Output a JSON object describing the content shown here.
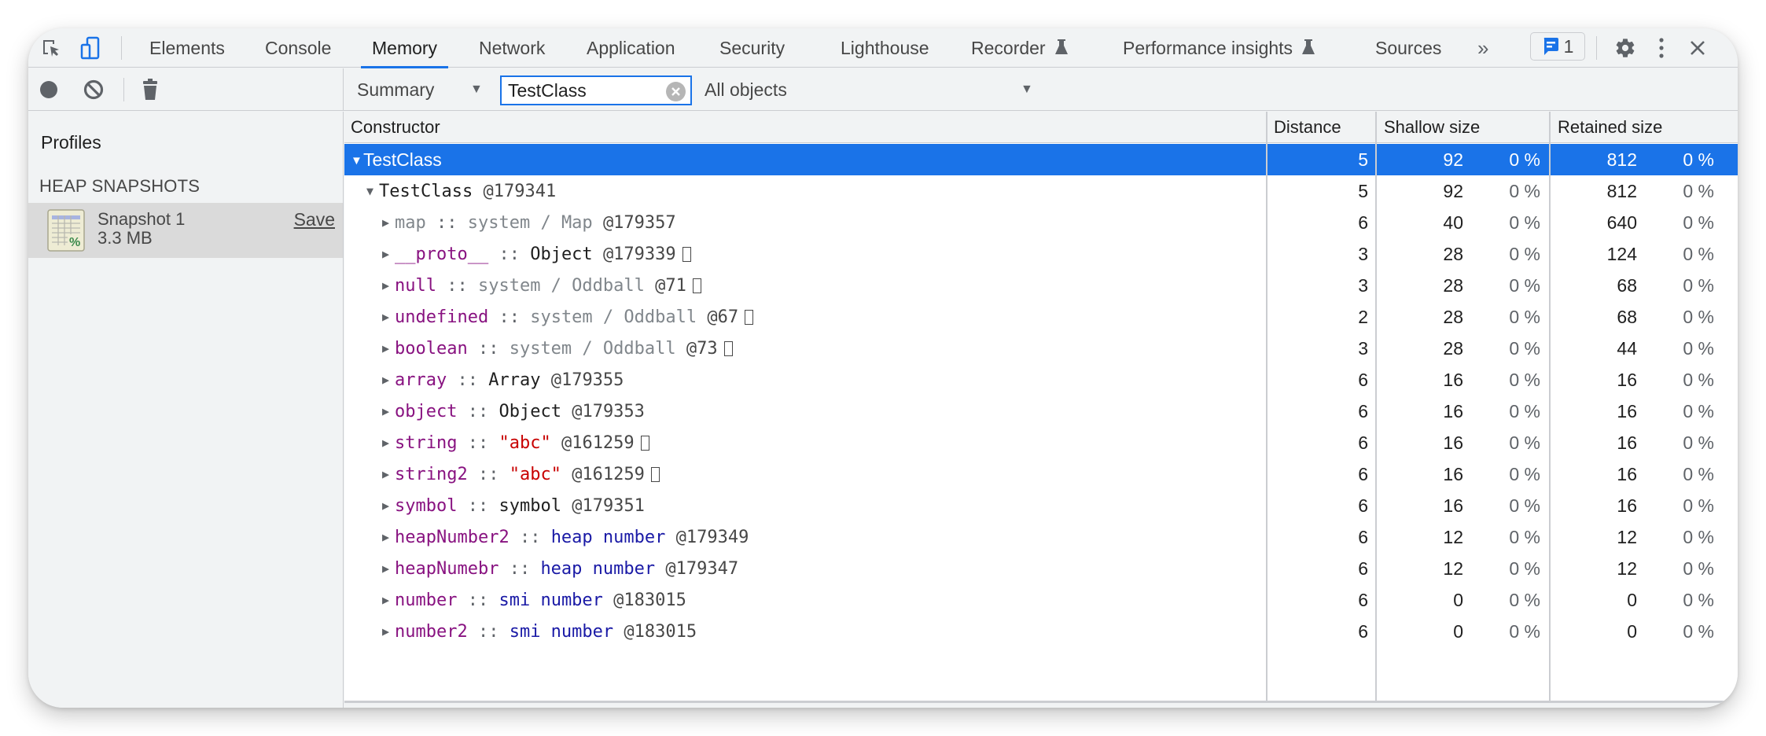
{
  "tabbar": {
    "tabs": [
      {
        "label": "Elements",
        "active": false
      },
      {
        "label": "Console",
        "active": false
      },
      {
        "label": "Memory",
        "active": true
      },
      {
        "label": "Network",
        "active": false
      },
      {
        "label": "Application",
        "active": false
      },
      {
        "label": "Security",
        "active": false
      },
      {
        "label": "Lighthouse",
        "active": false
      },
      {
        "label": "Recorder",
        "active": false,
        "experimental": true
      },
      {
        "label": "Performance insights",
        "active": false,
        "experimental": true
      },
      {
        "label": "Sources",
        "active": false
      }
    ],
    "more_tabs_label": "»",
    "issues_count": "1",
    "accent_color": "#1a73e8"
  },
  "toolbar": {
    "view_select": "Summary",
    "filter_value": "TestClass",
    "objects_select": "All objects"
  },
  "sidebar": {
    "title": "Profiles",
    "section": "HEAP SNAPSHOTS",
    "snapshots": [
      {
        "name": "Snapshot 1",
        "size": "3.3 MB",
        "save_label": "Save"
      }
    ]
  },
  "grid": {
    "columns": {
      "constructor": "Constructor",
      "distance": "Distance",
      "shallow": "Shallow size",
      "retained": "Retained size"
    },
    "rows": [
      {
        "level": 0,
        "expanded": true,
        "selected": true,
        "name": "TestClass",
        "distance": "5",
        "shallow": "92",
        "shallow_pct": "0 %",
        "retained": "812",
        "retained_pct": "0 %"
      },
      {
        "level": 1,
        "expanded": true,
        "prop": "",
        "type": "TestClass",
        "type_kind": "obj",
        "addr": "@179341",
        "box": false,
        "distance": "5",
        "shallow": "92",
        "shallow_pct": "0 %",
        "retained": "812",
        "retained_pct": "0 %"
      },
      {
        "level": 2,
        "prop": "map",
        "prop_kind": "sys",
        "type": "system / Map",
        "type_kind": "sys",
        "addr": "@179357",
        "box": false,
        "distance": "6",
        "shallow": "40",
        "shallow_pct": "0 %",
        "retained": "640",
        "retained_pct": "0 %"
      },
      {
        "level": 2,
        "prop": "__proto__",
        "prop_kind": "prop",
        "type": "Object",
        "type_kind": "obj",
        "addr": "@179339",
        "box": true,
        "distance": "3",
        "shallow": "28",
        "shallow_pct": "0 %",
        "retained": "124",
        "retained_pct": "0 %"
      },
      {
        "level": 2,
        "prop": "null",
        "prop_kind": "prop",
        "type": "system / Oddball",
        "type_kind": "sys",
        "addr": "@71",
        "box": true,
        "distance": "3",
        "shallow": "28",
        "shallow_pct": "0 %",
        "retained": "68",
        "retained_pct": "0 %"
      },
      {
        "level": 2,
        "prop": "undefined",
        "prop_kind": "prop",
        "type": "system / Oddball",
        "type_kind": "sys",
        "addr": "@67",
        "box": true,
        "distance": "2",
        "shallow": "28",
        "shallow_pct": "0 %",
        "retained": "68",
        "retained_pct": "0 %"
      },
      {
        "level": 2,
        "prop": "boolean",
        "prop_kind": "prop",
        "type": "system / Oddball",
        "type_kind": "sys",
        "addr": "@73",
        "box": true,
        "distance": "3",
        "shallow": "28",
        "shallow_pct": "0 %",
        "retained": "44",
        "retained_pct": "0 %"
      },
      {
        "level": 2,
        "prop": "array",
        "prop_kind": "prop",
        "type": "Array",
        "type_kind": "obj",
        "addr": "@179355",
        "box": false,
        "distance": "6",
        "shallow": "16",
        "shallow_pct": "0 %",
        "retained": "16",
        "retained_pct": "0 %"
      },
      {
        "level": 2,
        "prop": "object",
        "prop_kind": "prop",
        "type": "Object",
        "type_kind": "obj",
        "addr": "@179353",
        "box": false,
        "distance": "6",
        "shallow": "16",
        "shallow_pct": "0 %",
        "retained": "16",
        "retained_pct": "0 %"
      },
      {
        "level": 2,
        "prop": "string",
        "prop_kind": "prop",
        "type": "\"abc\"",
        "type_kind": "str",
        "addr": "@161259",
        "box": true,
        "distance": "6",
        "shallow": "16",
        "shallow_pct": "0 %",
        "retained": "16",
        "retained_pct": "0 %"
      },
      {
        "level": 2,
        "prop": "string2",
        "prop_kind": "prop",
        "type": "\"abc\"",
        "type_kind": "str",
        "addr": "@161259",
        "box": true,
        "distance": "6",
        "shallow": "16",
        "shallow_pct": "0 %",
        "retained": "16",
        "retained_pct": "0 %"
      },
      {
        "level": 2,
        "prop": "symbol",
        "prop_kind": "prop",
        "type": "symbol",
        "type_kind": "obj",
        "addr": "@179351",
        "box": false,
        "distance": "6",
        "shallow": "16",
        "shallow_pct": "0 %",
        "retained": "16",
        "retained_pct": "0 %"
      },
      {
        "level": 2,
        "prop": "heapNumber2",
        "prop_kind": "prop",
        "type": "heap number",
        "type_kind": "num-type",
        "addr": "@179349",
        "box": false,
        "distance": "6",
        "shallow": "12",
        "shallow_pct": "0 %",
        "retained": "12",
        "retained_pct": "0 %"
      },
      {
        "level": 2,
        "prop": "heapNumebr",
        "prop_kind": "prop",
        "type": "heap number",
        "type_kind": "num-type",
        "addr": "@179347",
        "box": false,
        "distance": "6",
        "shallow": "12",
        "shallow_pct": "0 %",
        "retained": "12",
        "retained_pct": "0 %"
      },
      {
        "level": 2,
        "prop": "number",
        "prop_kind": "prop",
        "type": "smi number",
        "type_kind": "num-type",
        "addr": "@183015",
        "box": false,
        "distance": "6",
        "shallow": "0",
        "shallow_pct": "0 %",
        "retained": "0",
        "retained_pct": "0 %"
      },
      {
        "level": 2,
        "prop": "number2",
        "prop_kind": "prop",
        "type": "smi number",
        "type_kind": "num-type",
        "addr": "@183015",
        "box": false,
        "distance": "6",
        "shallow": "0",
        "shallow_pct": "0 %",
        "retained": "0",
        "retained_pct": "0 %"
      }
    ]
  }
}
